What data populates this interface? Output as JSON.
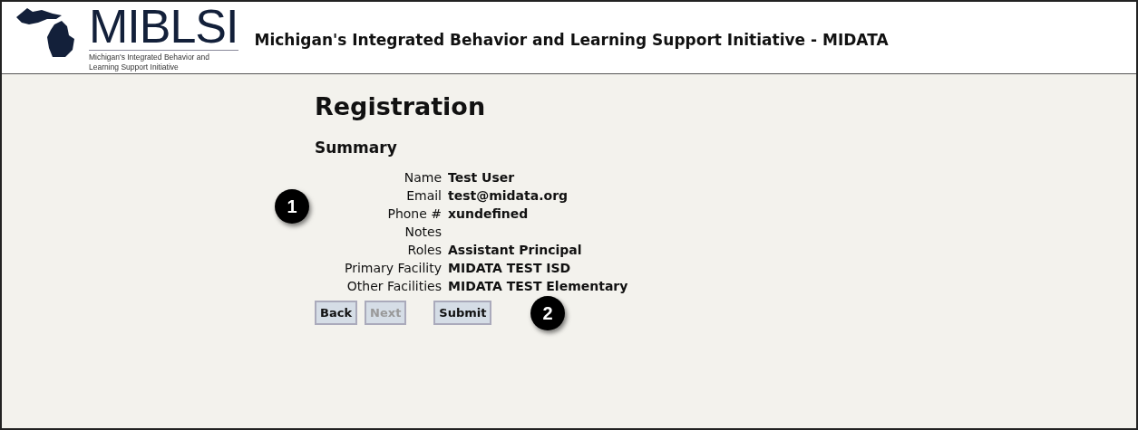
{
  "header": {
    "logo_title": "MIBLSI",
    "logo_subtitle": "Michigan's Integrated Behavior and Learning Support Initiative",
    "title": "Michigan's Integrated Behavior and Learning Support Initiative - MIDATA"
  },
  "page": {
    "heading": "Registration",
    "section": "Summary",
    "fields": [
      {
        "label": "Name",
        "value": "Test User"
      },
      {
        "label": "Email",
        "value": "test@midata.org"
      },
      {
        "label": "Phone #",
        "value": "xundefined"
      },
      {
        "label": "Notes"
      },
      {
        "label": "Roles",
        "value": "Assistant Principal"
      },
      {
        "label": "Primary Facility",
        "value": "MIDATA TEST ISD"
      },
      {
        "label": "Other Facilities",
        "value": "MIDATA TEST Elementary"
      }
    ],
    "buttons": [
      {
        "label": "Back",
        "disabled": false
      },
      {
        "label": "Next",
        "disabled": true
      },
      {
        "label": "Submit",
        "disabled": false
      }
    ],
    "callouts": [
      "1",
      "2"
    ]
  }
}
